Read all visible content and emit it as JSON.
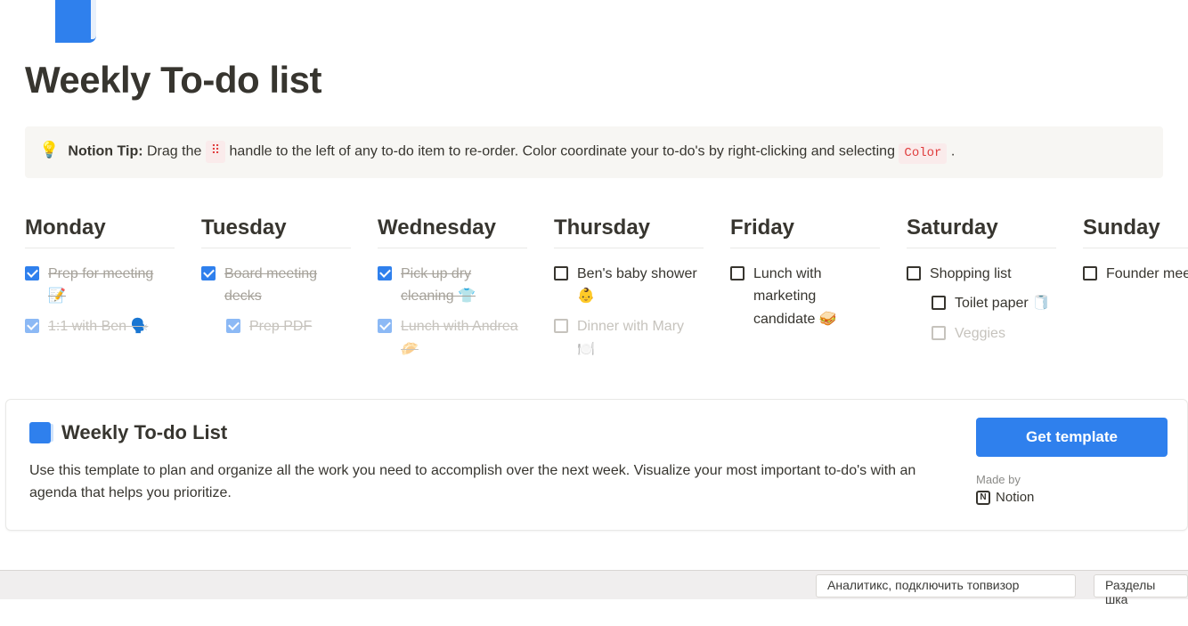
{
  "title": "Weekly To-do list",
  "tip": {
    "prefix": "Notion Tip:",
    "body_a": " Drag the ",
    "handle": "⠿",
    "body_b": " handle to the left of any to-do item to re-order. Color coordinate your to-do's by right-clicking and selecting ",
    "code": "Color",
    "body_c": " ."
  },
  "days": [
    {
      "name": "Monday",
      "items": [
        {
          "label": "Prep for meeting 📝",
          "checked": true,
          "style": "done"
        },
        {
          "label": "1:1 with Ben 🗣️",
          "checked": true,
          "style": "faded"
        }
      ]
    },
    {
      "name": "Tuesday",
      "items": [
        {
          "label": "Board meeting decks",
          "checked": true,
          "style": "done"
        },
        {
          "label": "Prep PDF",
          "checked": true,
          "style": "faded",
          "sub": true
        }
      ]
    },
    {
      "name": "Wednesday",
      "items": [
        {
          "label": "Pick up dry cleaning 👕",
          "checked": true,
          "style": "done"
        },
        {
          "label": "Lunch with Andrea 🥟",
          "checked": true,
          "style": "faded"
        }
      ]
    },
    {
      "name": "Thursday",
      "items": [
        {
          "label": "Ben's baby shower 👶",
          "checked": false
        },
        {
          "label": "Dinner with Mary 🍽️",
          "checked": false,
          "style": "faded-unchecked"
        }
      ]
    },
    {
      "name": "Friday",
      "items": [
        {
          "label": "Lunch with marketing candidate 🥪",
          "checked": false
        }
      ]
    },
    {
      "name": "Saturday",
      "items": [
        {
          "label": "Shopping list",
          "checked": false
        },
        {
          "label": "Toilet paper 🧻",
          "checked": false,
          "sub": true
        },
        {
          "label": "Veggies",
          "checked": false,
          "sub": true,
          "style": "faded-unchecked"
        }
      ]
    },
    {
      "name": "Sunday",
      "items": [
        {
          "label": "Founder meetup",
          "checked": false
        }
      ]
    }
  ],
  "footer": {
    "title": "Weekly To-do List",
    "desc": "Use this template to plan and organize all the work you need to accomplish over the next week. Visualize your most important to-do's with an agenda that helps you prioritize.",
    "button": "Get template",
    "madeby_label": "Made by",
    "madeby_brand": "Notion"
  },
  "strip": {
    "left": "Аналитикс, подключить топвизор",
    "right": "Разделы шка"
  }
}
